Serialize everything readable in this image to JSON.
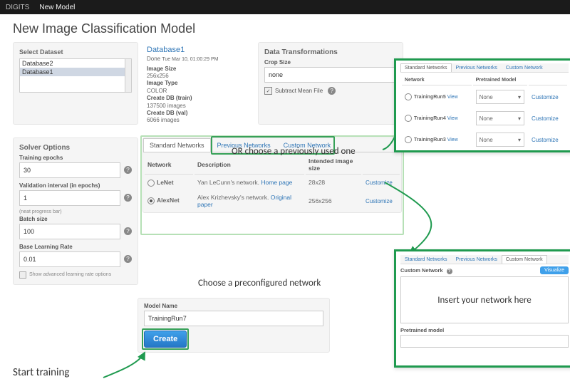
{
  "topbar": {
    "brand": "DIGITS",
    "new_model": "New Model"
  },
  "page_title": "New Image Classification Model",
  "select_dataset": {
    "title": "Select Dataset",
    "options": [
      "Database2",
      "Database1"
    ],
    "selected": "Database1"
  },
  "dataset_info": {
    "title": "Database1",
    "done_prefix": "Done",
    "done_time": "Tue Mar 10, 01:00:29 PM",
    "image_size_label": "Image Size",
    "image_size": "256x256",
    "image_type_label": "Image Type",
    "image_type": "COLOR",
    "db_train_label": "Create DB (train)",
    "db_train": "137500 images",
    "db_val_label": "Create DB (val)",
    "db_val": "6066 images"
  },
  "data_transforms": {
    "title": "Data Transformations",
    "crop_label": "Crop Size",
    "crop_value": "none",
    "subtract_label": "Subtract Mean File"
  },
  "solver": {
    "title": "Solver Options",
    "epochs_label": "Training epochs",
    "epochs": "30",
    "val_label": "Validation interval (in epochs)",
    "val": "1",
    "progress_note": "(neat progress bar)",
    "batch_label": "Batch size",
    "batch": "100",
    "lr_label": "Base Learning Rate",
    "lr": "0.01",
    "adv_label": "Show advanced learning rate options"
  },
  "net_tabs": {
    "std": "Standard Networks",
    "prev": "Previous Networks",
    "custom": "Custom Network"
  },
  "net_table": {
    "col_net": "Network",
    "col_desc": "Description",
    "col_size": "Intended image size",
    "rows": [
      {
        "sel": false,
        "name": "LeNet",
        "desc_prefix": "Yan LeCunn's network.",
        "desc_link": "Home page",
        "size": "28x28"
      },
      {
        "sel": true,
        "name": "AlexNet",
        "desc_prefix": "Alex Krizhevsky's network.",
        "desc_link": "Original paper",
        "size": "256x256"
      }
    ],
    "customize": "Customize"
  },
  "model_name": {
    "label": "Model Name",
    "value": "TrainingRun7",
    "create": "Create"
  },
  "captions": {
    "or_prev": "OR choose a previously used one",
    "choose_pre": "Choose a preconfigured network",
    "insert": "Insert your network here",
    "start": "Start training"
  },
  "inset_prev": {
    "col_net": "Network",
    "col_model": "Pretrained Model",
    "rows": [
      "TrainingRun5",
      "TrainingRun4",
      "TrainingRun3"
    ],
    "view": "View",
    "none": "None",
    "customize": "Customize"
  },
  "inset_custom": {
    "title": "Custom Network",
    "visualize": "Visualize",
    "pretrained": "Pretrained model"
  }
}
